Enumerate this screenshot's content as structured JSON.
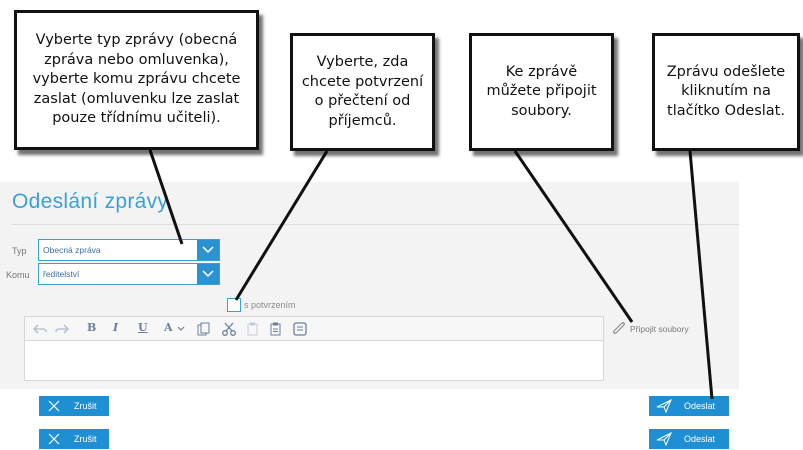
{
  "callouts": {
    "c1": "Vyberte typ zprávy (obecná zpráva nebo omluvenka), vyberte komu zprávu chcete zaslat (omluvenku lze zaslat pouze třídnímu učiteli).",
    "c2": "Vyberte, zda chcete potvrzení o přečtení od příjemců.",
    "c3": "Ke zprávě můžete připojit soubory.",
    "c4": "Zprávu odešlete kliknutím na tlačítko Odeslat."
  },
  "form": {
    "title": "Odeslání zprávy",
    "typ_label": "Typ",
    "typ_value": "Obecná zpráva",
    "komu_label": "Komu",
    "komu_value": "ředitelství",
    "confirm_label": "s potvrzením",
    "attach_label": "Připojit soubory"
  },
  "toolbar": {
    "bold": "B",
    "italic": "I",
    "underline": "U",
    "font_color": "A"
  },
  "buttons": {
    "cancel": "Zrušit",
    "send": "Odeslat"
  },
  "colors": {
    "accent": "#2b93d1",
    "title": "#3aa0d6"
  }
}
